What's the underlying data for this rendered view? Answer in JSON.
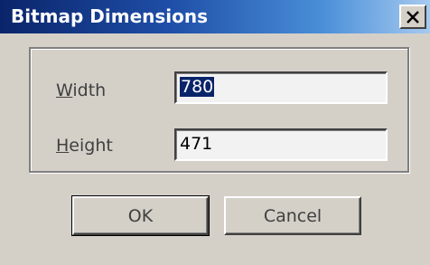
{
  "window": {
    "title": "Bitmap Dimensions",
    "close_icon": "close-icon",
    "title_gradient": [
      "#0a246a",
      "#a6caf0"
    ]
  },
  "fields": {
    "width": {
      "label_underline": "W",
      "label_rest": "idth",
      "value": "780"
    },
    "height": {
      "label_underline": "H",
      "label_rest": "eight",
      "value": "471"
    }
  },
  "buttons": {
    "ok_label": "OK",
    "cancel_label": "Cancel"
  },
  "colors": {
    "face": "#d4d0c8",
    "field_bg": "#f2f2f2",
    "selection": "#0a246a"
  }
}
